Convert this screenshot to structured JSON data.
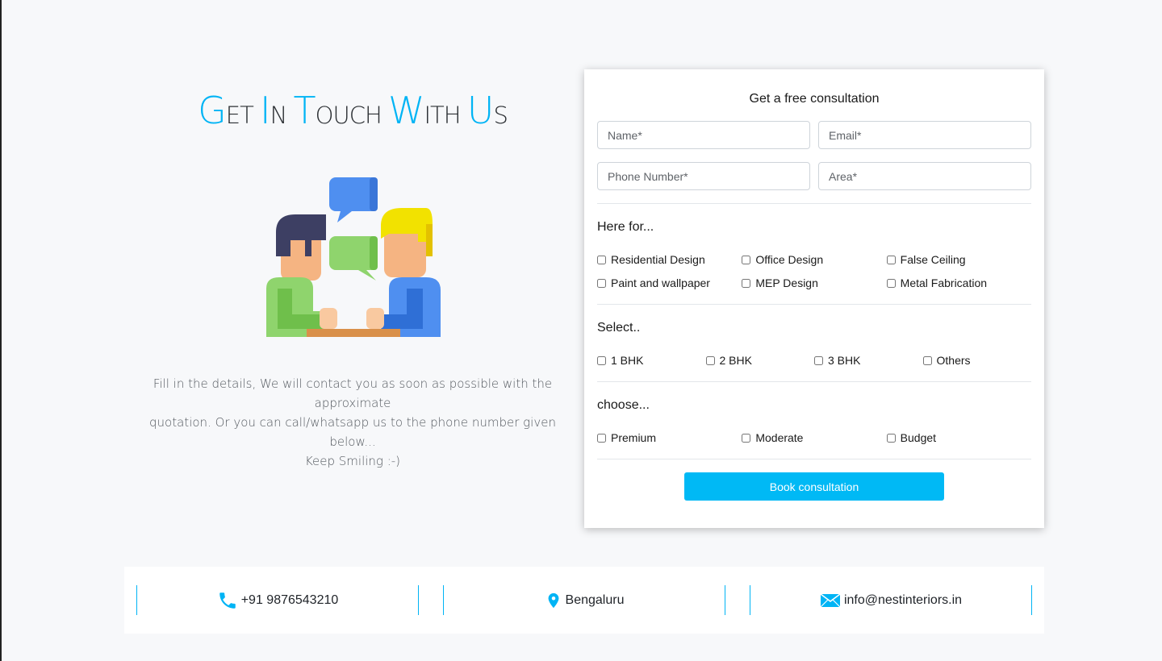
{
  "heading": {
    "parts": [
      {
        "cap": "G",
        "rest": "ET"
      },
      {
        "cap": "I",
        "rest": "N"
      },
      {
        "cap": "T",
        "rest": "OUCH"
      },
      {
        "cap": "W",
        "rest": "ITH"
      },
      {
        "cap": "U",
        "rest": "S"
      }
    ]
  },
  "description": {
    "line1": "Fill in the details, We will contact you as soon as possible with the approximate",
    "line2": "quotation. Or you can call/whatsapp us to the phone number given below...",
    "line3": "Keep Smiling :-)"
  },
  "form": {
    "title": "Get a free consultation",
    "name_placeholder": "Name*",
    "email_placeholder": "Email*",
    "phone_placeholder": "Phone Number*",
    "area_placeholder": "Area*",
    "here_for_label": "Here for...",
    "here_for_options": [
      "Residential Design",
      "Office Design",
      "False Ceiling",
      "Paint and wallpaper",
      "MEP Design",
      "Metal Fabrication"
    ],
    "select_label": "Select..",
    "select_options": [
      "1 BHK",
      "2 BHK",
      "3 BHK",
      "Others"
    ],
    "choose_label": "choose...",
    "choose_options": [
      "Premium",
      "Moderate",
      "Budget"
    ],
    "submit_label": "Book consultation"
  },
  "contact": {
    "phone": "+91 9876543210",
    "location": "Bengaluru",
    "email": "info@nestinteriors.in",
    "icons": [
      "phone-icon",
      "location-pin-icon",
      "envelope-icon"
    ],
    "accent_color": "#00b4f5"
  }
}
